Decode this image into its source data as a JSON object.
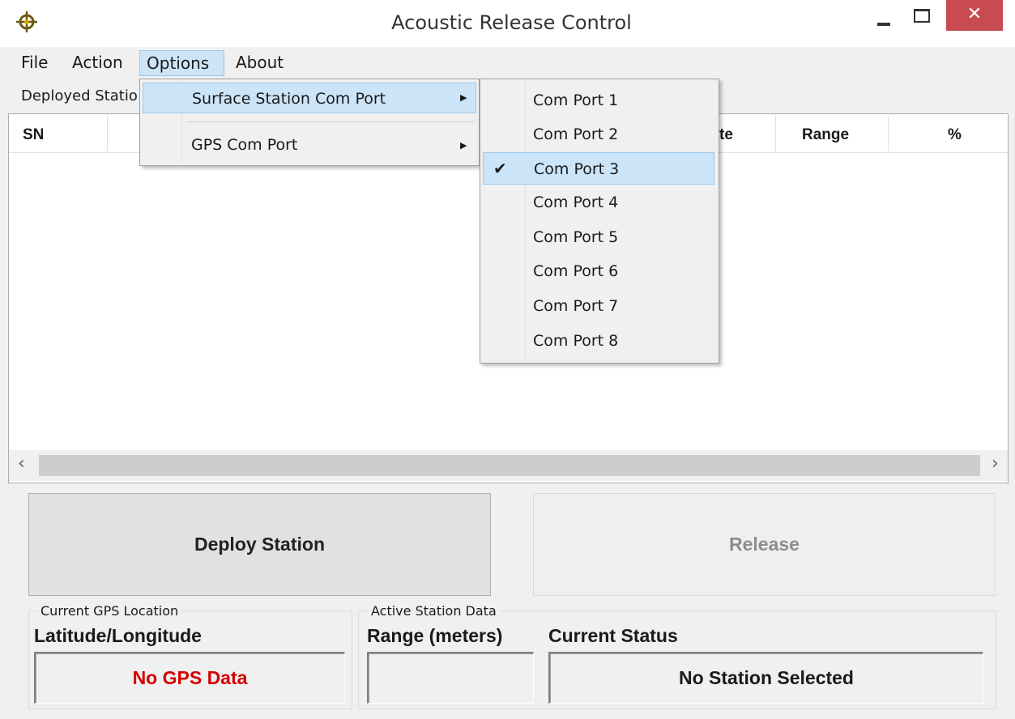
{
  "window": {
    "title": "Acoustic Release Control",
    "close_glyph": "✕",
    "icon": "crosshair-icon"
  },
  "menubar": {
    "file": "File",
    "action": "Action",
    "options": "Options",
    "about": "About"
  },
  "tab_label": "Deployed Statio",
  "columns": [
    "SN",
    "te",
    "Range",
    "%"
  ],
  "options_menu": {
    "items": [
      {
        "label": "Surface Station Com Port",
        "highlighted": true
      },
      {
        "label": "GPS Com Port",
        "highlighted": false
      }
    ]
  },
  "com_ports": {
    "items": [
      "Com Port 1",
      "Com Port 2",
      "Com Port 3",
      "Com Port 4",
      "Com Port 5",
      "Com Port 6",
      "Com Port 7",
      "Com Port 8"
    ],
    "checked": "Com Port 3"
  },
  "buttons": {
    "deploy": "Deploy Station",
    "release": "Release"
  },
  "gps_group": {
    "legend": "Current GPS Location",
    "label": "Latitude/Longitude",
    "value": "No GPS Data",
    "value_color": "#d40000"
  },
  "station_group": {
    "legend": "Active Station Data",
    "range_label": "Range (meters)",
    "range_value": "",
    "status_label": "Current Status",
    "status_value": "No Station Selected"
  },
  "colors": {
    "highlight": "#cce4f7",
    "close_button": "#c74b50"
  }
}
